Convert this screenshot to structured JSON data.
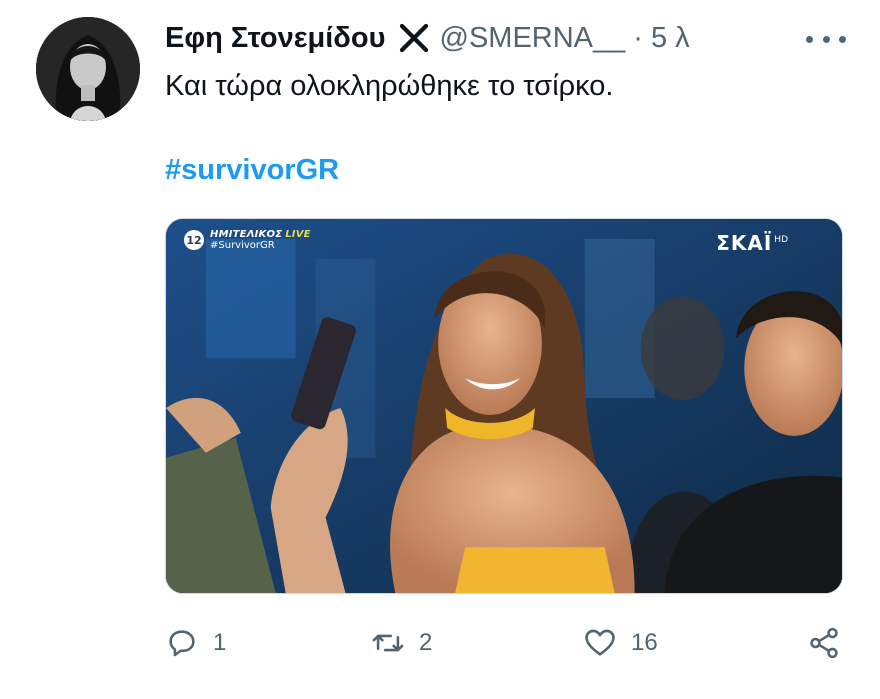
{
  "author": {
    "display_name": "Εφη Στονεμίδου",
    "handle": "@SMERNA__",
    "separator": "·",
    "time": "5 λ",
    "badge_icon": "x-icon",
    "avatar": "avatar"
  },
  "menu": {
    "icon": "more-dots-icon"
  },
  "tweet": {
    "text": "Και τώρα ολοκληρώθηκε το τσίρκο.",
    "hashtag": "#survivorGR"
  },
  "media": {
    "overlay": {
      "channel_badge": "12",
      "program": "ΗΜΙΤΕΛΙΚΟΣ",
      "live": "LIVE",
      "tag": "#SurvivorGR",
      "network": "ΣΚΑΪ",
      "network_suffix": "HD"
    }
  },
  "actions": {
    "reply": {
      "count": "1",
      "icon": "reply-icon"
    },
    "retweet": {
      "count": "2",
      "icon": "retweet-icon"
    },
    "like": {
      "count": "16",
      "icon": "heart-icon"
    },
    "share": {
      "icon": "share-icon"
    }
  },
  "colors": {
    "link": "#1d9bf0",
    "secondary_text": "#536471",
    "primary_text": "#0f1419"
  }
}
